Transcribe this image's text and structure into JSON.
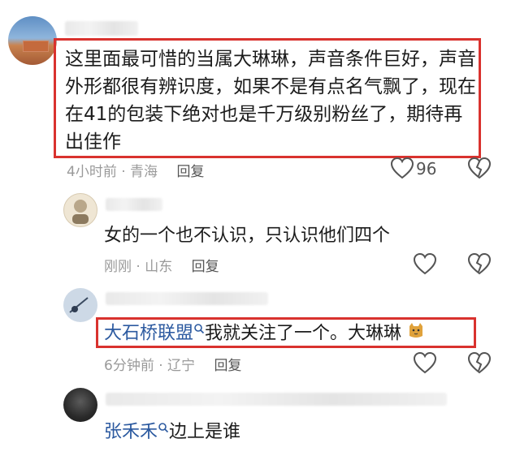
{
  "comments": [
    {
      "text": "这里面最可惜的当属大琳琳，声音条件巨好，声音外形都很有辨识度，如果不是有点名气飘了，现在在41的包装下绝对也是千万级别粉丝了，期待再出佳作",
      "meta": "4小时前 · 青海",
      "reply_label": "回复",
      "like_count": "96"
    },
    {
      "text": "女的一个也不认识，只认识他们四个",
      "meta": "刚刚 · 山东",
      "reply_label": "回复"
    },
    {
      "username": "大石桥联盟",
      "text": "我就关注了一个。大琳琳",
      "meta": "6分钟前 · 辽宁",
      "reply_label": "回复"
    },
    {
      "username": "张禾禾",
      "text": "边上是谁"
    }
  ],
  "icons": {
    "like": "heart-outline-icon",
    "dislike": "broken-heart-icon",
    "search_badge": "search-icon",
    "emoji": "cat-emoji-icon"
  },
  "colors": {
    "highlight": "#d9322e",
    "username": "#2c5aa0",
    "meta": "#9a9a9a"
  }
}
